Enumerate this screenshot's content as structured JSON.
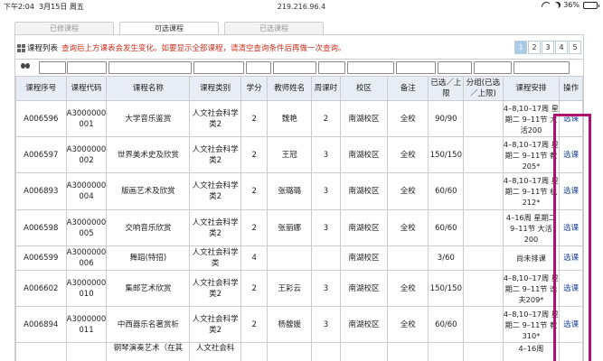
{
  "status": {
    "time": "下午2:04",
    "date": "3月15日 周五",
    "url": "219.216.96.4",
    "battery": "36%",
    "battery_level": 0.36
  },
  "tabs": [
    {
      "label": "已修课程",
      "active": false
    },
    {
      "label": "可选课程",
      "active": true
    },
    {
      "label": "已选课程",
      "active": false
    }
  ],
  "list": {
    "title": "课程列表",
    "notice": "查询后上方课表会发生变化。如要显示全部课程，请清空查询条件后再做一次查询。",
    "pages": [
      "1",
      "2",
      "3",
      "4",
      "5"
    ],
    "active_page": "1"
  },
  "table": {
    "headers": [
      "课程序号",
      "课程代码",
      "课程名称",
      "课程类别",
      "学分",
      "教师姓名",
      "周课时",
      "校区",
      "备注",
      "已选／上限",
      "分组(已选／上限)",
      "课程安排",
      "操作"
    ],
    "rows": [
      [
        "A006596",
        "A3000000001",
        "大学音乐鉴赏",
        "人文社会科学类2",
        "2",
        "魏艳",
        "2",
        "南湖校区",
        "全校",
        "90/90",
        "",
        "4–8,10–17周 星期二 9–11节 大活200",
        "选课"
      ],
      [
        "A006597",
        "A3000000002",
        "世界美术史及欣赏",
        "人文社会科学类2",
        "2",
        "王冠",
        "3",
        "南湖校区",
        "全校",
        "150/150",
        "",
        "4–8,10–17周 星期二 9–11节 教205*",
        "选课"
      ],
      [
        "A006893",
        "A3000000004",
        "版画艺术及欣赏",
        "人文社会科学类2",
        "2",
        "张璐璐",
        "3",
        "南湖校区",
        "全校",
        "60/60",
        "",
        "4–8,10–17周 星期二 9–11节 机212*",
        "选课"
      ],
      [
        "A006598",
        "A3000000005",
        "交响音乐欣赏",
        "人文社会科学类2",
        "2",
        "张丽娜",
        "3",
        "南湖校区",
        "全校",
        "60/60",
        "",
        "4–16周 星期二 9–11节 大活200",
        "选课"
      ],
      [
        "A006599",
        "A3000000006",
        "舞蹈(特招)",
        "人文社会科学类",
        "4",
        "",
        "",
        "南湖校区",
        "",
        "3/60",
        "",
        "尚未排课",
        "选课"
      ],
      [
        "A006602",
        "A3000000010",
        "集邮艺术欣赏",
        "人文社会科学类2",
        "2",
        "王彩云",
        "3",
        "南湖校区",
        "全校",
        "150/150",
        "",
        "4–8,10–17周 星期二 9–11节 逸夫209*",
        "选课"
      ],
      [
        "A006894",
        "A3000000011",
        "中西器乐名著赏析",
        "人文社会科学类2",
        "2",
        "杨馥媛",
        "3",
        "南湖校区",
        "全校",
        "60/60",
        "",
        "4–8,10–17周 星期二 9–11节 教310*",
        "选课"
      ],
      [
        "",
        "",
        "钢琴演奏艺术（在其",
        "人文社会科",
        "",
        "",
        "",
        "",
        "",
        "",
        "",
        "4–16周",
        ""
      ]
    ]
  }
}
